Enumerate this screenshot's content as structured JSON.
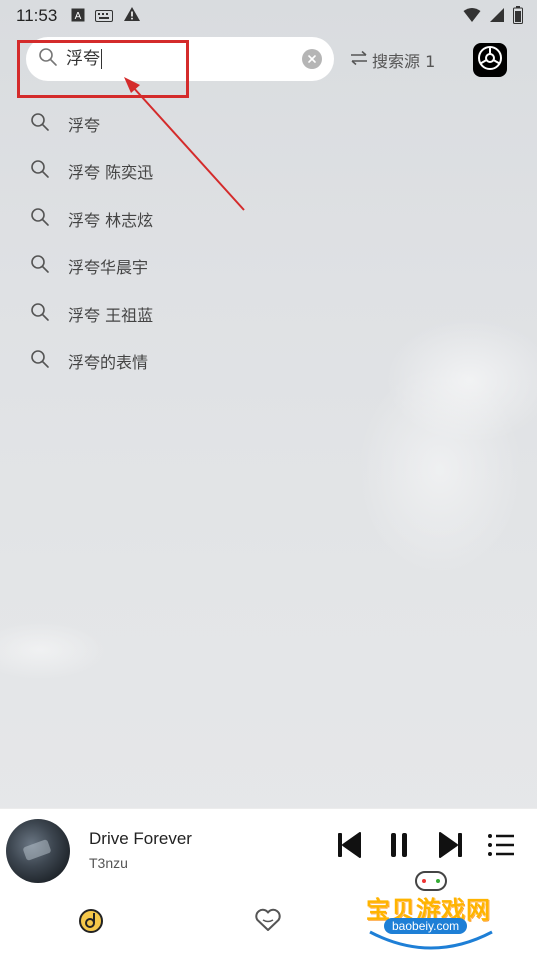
{
  "status_bar": {
    "time": "11:53",
    "icons": [
      "a-box-icon",
      "keyboard-icon",
      "warning-icon",
      "wifi-icon",
      "signal-icon",
      "battery-icon"
    ]
  },
  "search": {
    "value": "浮夸",
    "clear_icon": "clear-icon"
  },
  "source_switch": {
    "label": "搜索源 1",
    "icon": "swap-icon"
  },
  "settings_icon": "settings-icon",
  "suggestions": [
    {
      "text": "浮夸"
    },
    {
      "text": "浮夸 陈奕迅"
    },
    {
      "text": "浮夸 林志炫"
    },
    {
      "text": "浮夸华晨宇"
    },
    {
      "text": "浮夸 王祖蓝"
    },
    {
      "text": "浮夸的表情"
    }
  ],
  "player": {
    "title": "Drive Forever",
    "artist": "T3nzu",
    "controls": [
      "previous-icon",
      "pause-icon",
      "next-icon",
      "playlist-icon"
    ]
  },
  "bottom_nav": [
    {
      "icon": "music-disc-icon",
      "active": true
    },
    {
      "icon": "heart-icon",
      "active": false
    }
  ],
  "watermark": {
    "text": "宝贝游戏网",
    "sub": "baobeiy.com"
  },
  "colors": {
    "annotation": "#d42b2b",
    "accent": "#e8a623"
  }
}
